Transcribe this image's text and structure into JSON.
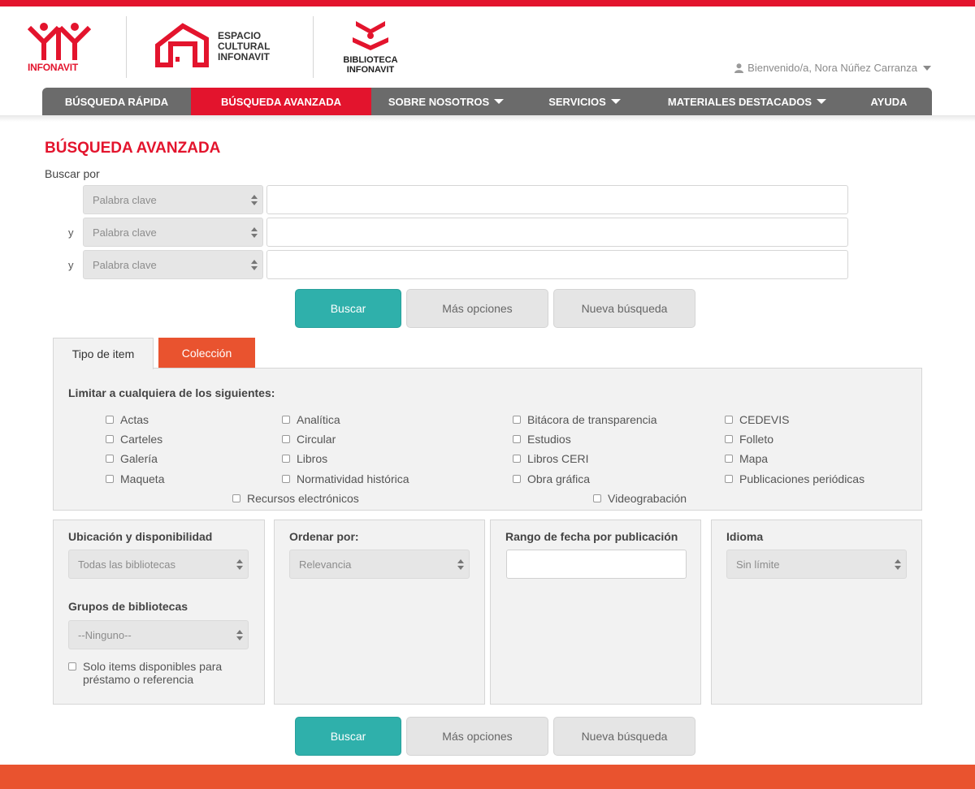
{
  "brand": {
    "infonavit": "INFONAVIT",
    "espacio": [
      "ESPACIO",
      "CULTURAL",
      "INFONAVIT"
    ],
    "biblioteca": [
      "BIBLIOTECA",
      "INFONAVIT"
    ],
    "red": "#e3142d",
    "orange": "#e9532f",
    "teal": "#2fb0ab"
  },
  "user": {
    "greeting": "Bienvenido/a, Nora Núñez Carranza"
  },
  "nav": {
    "items": [
      {
        "label": "BÚSQUEDA RÁPIDA",
        "active": false,
        "dropdown": false
      },
      {
        "label": "BÚSQUEDA AVANZADA",
        "active": true,
        "dropdown": false
      },
      {
        "label": "SOBRE NOSOTROS",
        "active": false,
        "dropdown": true
      },
      {
        "label": "SERVICIOS",
        "active": false,
        "dropdown": true
      },
      {
        "label": "MATERIALES DESTACADOS",
        "active": false,
        "dropdown": true
      },
      {
        "label": "AYUDA",
        "active": false,
        "dropdown": false
      }
    ]
  },
  "search": {
    "title": "BÚSQUEDA AVANZADA",
    "label": "Buscar por",
    "rows": [
      {
        "conj": "",
        "field": "Palabra clave",
        "value": ""
      },
      {
        "conj": "y",
        "field": "Palabra clave",
        "value": ""
      },
      {
        "conj": "y",
        "field": "Palabra clave",
        "value": ""
      }
    ],
    "buttons": {
      "search": "Buscar",
      "more": "Más opciones",
      "new": "Nueva búsqueda"
    }
  },
  "tabs": [
    {
      "label": "Tipo de item",
      "active": true
    },
    {
      "label": "Colección",
      "active": false
    }
  ],
  "item_types": {
    "heading": "Limitar a cualquiera de los siguientes:",
    "options": [
      "Actas",
      "Carteles",
      "Galería",
      "Maqueta",
      "Analítica",
      "Circular",
      "Libros",
      "Normatividad histórica",
      "Bitácora de transparencia",
      "Estudios",
      "Libros CERI",
      "Obra gráfica",
      "CEDEVIS",
      "Folleto",
      "Mapa",
      "Publicaciones periódicas",
      "Recursos electrónicos",
      "Videograbación"
    ]
  },
  "filters": {
    "location": {
      "heading": "Ubicación y disponibilidad",
      "value": "Todas las bibliotecas"
    },
    "groups": {
      "heading": "Grupos de bibliotecas",
      "value": "--Ninguno--"
    },
    "available_only": "Solo items disponibles para préstamo o referencia",
    "sort": {
      "heading": "Ordenar por:",
      "value": "Relevancia"
    },
    "date_range": {
      "heading": "Rango de fecha por publicación",
      "value": ""
    },
    "language": {
      "heading": "Idioma",
      "value": "Sin límite"
    }
  }
}
